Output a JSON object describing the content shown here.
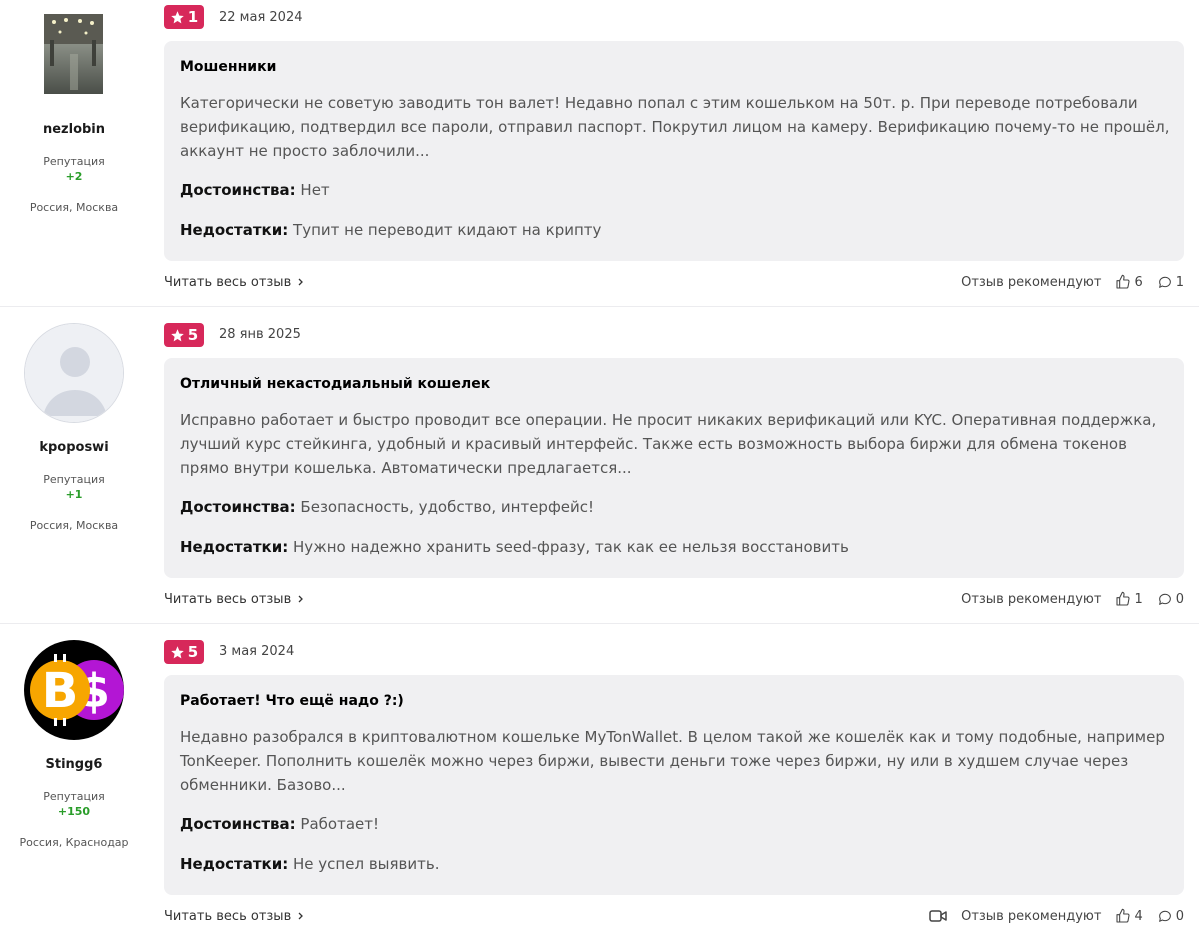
{
  "labels": {
    "reputation": "Репутация",
    "pros": "Достоинства:",
    "cons": "Недостатки:",
    "read_more": "Читать весь отзыв",
    "recommend": "Отзыв рекомендуют"
  },
  "colors": {
    "rating_badge": "#d7285a",
    "reputation_positive": "#2a9d2a",
    "card_bg": "#f0f0f2"
  },
  "reviews": [
    {
      "user": {
        "name": "nezlobin",
        "reputation": "+2",
        "location": "Россия, Москва",
        "avatar": "photo"
      },
      "rating": "1",
      "date": "22 мая 2024",
      "title": "Мошенники",
      "text": "Категорически не советую заводить тон валет! Недавно попал с этим кошельком на 50т. р. При переводе потребовали верификацию, подтвердил все пароли, отправил паспорт. Покрутил лицом на камеру. Верификацию почему-то не прошёл, аккаунт не просто заблочили...",
      "pros": "Нет",
      "cons": "Тупит не переводит кидают на крипту",
      "likes": "6",
      "comments": "1"
    },
    {
      "user": {
        "name": "kpoposwi",
        "reputation": "+1",
        "location": "Россия, Москва",
        "avatar": "default"
      },
      "rating": "5",
      "date": "28 янв 2025",
      "title": "Отличный некастодиальный кошелек",
      "text": "Исправно работает и быстро проводит все операции. Не просит никаких верификаций или KYC. Оперативная поддержка, лучший курс стейкинга, удобный и красивый интерфейс. Также есть возможность выбора биржи для обмена токенов прямо внутри кошелька. Автоматически предлагается...",
      "pros": "Безопасность, удобство, интерфейс!",
      "cons": "Нужно надежно хранить seed-фразу, так как ее нельзя восстановить",
      "likes": "1",
      "comments": "0"
    },
    {
      "user": {
        "name": "Stingg6",
        "reputation": "+150",
        "location": "Россия, Краснодар",
        "avatar": "crypto"
      },
      "rating": "5",
      "date": "3 мая 2024",
      "title": "Работает! Что ещё надо ?:)",
      "text": "Недавно разобрался в криптовалютном кошельке MyTonWallet. В целом такой же кошелёк как и тому подобные, например TonKeeper. Пополнить кошелёк можно через биржи, вывести деньги тоже через биржи, ну или в худшем случае через обменники. Базово...",
      "pros": "Работает!",
      "cons": "Не успел выявить.",
      "likes": "4",
      "comments": "0"
    }
  ]
}
